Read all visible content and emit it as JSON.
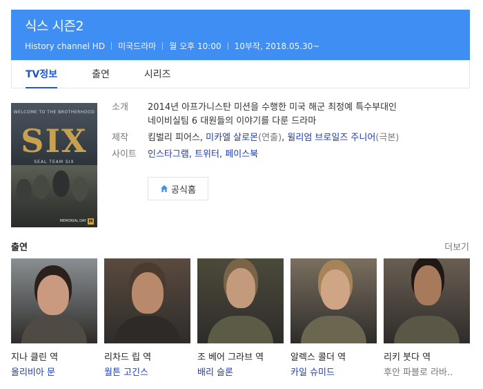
{
  "header": {
    "title": "식스 시즌2",
    "meta": [
      "History channel HD",
      "미국드라마",
      "월 오후 10:00",
      "10부작, 2018.05.30~"
    ]
  },
  "tabs": [
    {
      "label": "TV정보",
      "active": true
    },
    {
      "label": "출연",
      "active": false
    },
    {
      "label": "시리즈",
      "active": false
    }
  ],
  "poster": {
    "tagline": "WELCOME TO THE BROTHERHOOD",
    "title": "SIX",
    "subtitle": "SEAL TEAM SIX",
    "footer": "MEMORIAL DAY",
    "logo": "H"
  },
  "info": {
    "synopsis_label": "소개",
    "synopsis_line1": "2014년 아프가니스탄 미션을 수행한 미국 해군 최정예 특수부대인",
    "synopsis_line2": "네이비실팀 6 대원들의 이야기를 다룬 드라마",
    "production_label": "제작",
    "producer1": "킴벌리 피어스",
    "producer2": "미카엘 살로몬",
    "producer2_role": "(연출)",
    "producer3": "윌리엄 브로일즈 주니어",
    "producer3_role": "(극본)",
    "site_label": "사이트",
    "sites": [
      "인스타그램",
      "트위터",
      "페이스북"
    ],
    "official_button": "공식홈"
  },
  "cast_section": {
    "title": "출연",
    "more": "더보기"
  },
  "cast": [
    {
      "role": "지나 클린 역",
      "actor": "올리비아 문",
      "bg": "#8a8f92",
      "skin": "#c99a80",
      "hair": "#2a211c",
      "cloth": "#4f4a44"
    },
    {
      "role": "리차드 립 역",
      "actor": "월튼 고긴스",
      "bg": "#5a4a3f",
      "skin": "#b9896c",
      "hair": "#4a3a2f",
      "cloth": "#2e2a28"
    },
    {
      "role": "조 베어 그라브 역",
      "actor": "배리 슬론",
      "bg": "#4b4a3a",
      "skin": "#c49a7c",
      "hair": "#7a6448",
      "cloth": "#5c5b45"
    },
    {
      "role": "알렉스 콜더 역",
      "actor": "카일 슈미드",
      "bg": "#7a6f5f",
      "skin": "#d0a585",
      "hair": "#a58459",
      "cloth": "#6a6650"
    },
    {
      "role": "리키 붓다 역",
      "actor": "후안 파블로 라바..",
      "actor_grey": true,
      "bg": "#6a5e52",
      "skin": "#a87a5c",
      "hair": "#1f1814",
      "cloth": "#5a5746"
    }
  ]
}
